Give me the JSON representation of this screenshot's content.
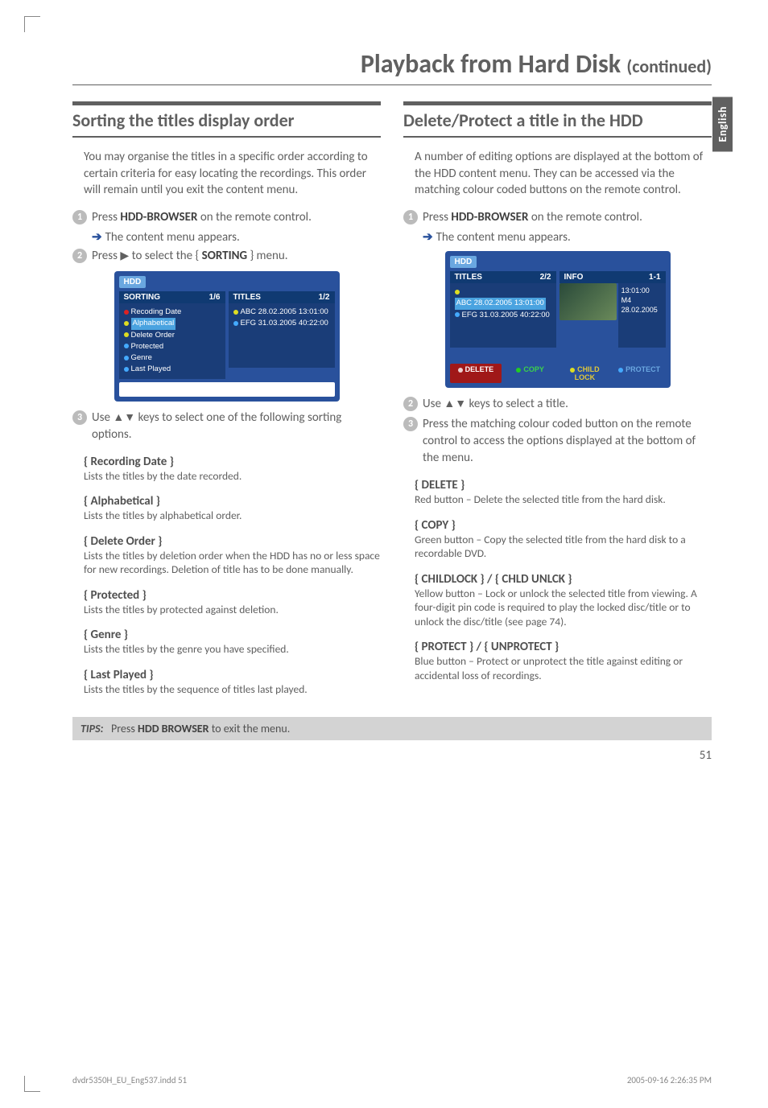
{
  "page": {
    "title_main": "Playback from Hard Disk",
    "title_cont": "(continued)",
    "lang_tab": "English",
    "page_number": "51",
    "footer_file": "dvdr5350H_EU_Eng537.indd   51",
    "footer_ts": "2005-09-16   2:26:35 PM"
  },
  "tips": {
    "label": "TIPS:",
    "text": "Press",
    "button": "HDD BROWSER",
    "text2": "to exit the menu."
  },
  "left": {
    "heading": "Sorting the titles display order",
    "intro": "You may organise the titles in a specific order according to certain criteria for easy locating the recordings. This order will remain until you exit the content menu.",
    "step1_a": "Press",
    "step1_b": "HDD-BROWSER",
    "step1_c": "on the remote control.",
    "step1_res": "The content menu appears.",
    "step2_a": "Press",
    "step2_tri": "▶",
    "step2_b": "to select the {",
    "step2_c": "SORTING",
    "step2_d": "} menu.",
    "step3_a": "Use",
    "step3_tri": "▲▼",
    "step3_b": "keys to select one of the following sorting options.",
    "opts": {
      "rec_h": "{ Recording Date }",
      "rec_d": "Lists the titles by the date recorded.",
      "alpha_h": "{ Alphabetical }",
      "alpha_d": "Lists the titles by alphabetical order.",
      "del_h": "{ Delete Order }",
      "del_d": "Lists the titles by deletion order when the HDD has no or less space for new recordings. Deletion of title has to be done manually.",
      "prot_h": "{ Protected }",
      "prot_d": "Lists the titles by protected against deletion.",
      "genre_h": "{ Genre }",
      "genre_d": "Lists the titles by the genre you have specified.",
      "last_h": "{ Last Played }",
      "last_d": "Lists the titles by the sequence of titles last played."
    },
    "osd": {
      "hdd": "HDD",
      "sorting_hd": "SORTING",
      "sorting_ct": "1/6",
      "titles_hd": "TITLES",
      "titles_ct": "1/2",
      "items": [
        "Recoding Date",
        "Alphabetical",
        "Delete Order",
        "Protected",
        "Genre",
        "Last Played"
      ],
      "titles": [
        "ABC 28.02.2005  13:01:00",
        "EFG 31.03.2005  40:22:00"
      ]
    }
  },
  "right": {
    "heading": "Delete/Protect a title in the HDD",
    "intro": "A number of editing options are displayed at the bottom of the HDD content menu. They can be accessed via the matching colour coded buttons on the remote control.",
    "step1_a": "Press",
    "step1_b": "HDD-BROWSER",
    "step1_c": "on the remote control.",
    "step1_res": "The content menu appears.",
    "step2_a": "Use",
    "step2_tri": "▲▼",
    "step2_b": "keys to select a title.",
    "step3": "Press the matching colour coded button on the remote control to access the options displayed at the bottom of the menu.",
    "opts": {
      "del_h": "{ DELETE }",
      "del_d": "Red button – Delete the selected title from the hard disk.",
      "copy_h": "{ COPY }",
      "copy_d": "Green button – Copy the selected title from the hard disk to a recordable DVD.",
      "lock_h": "{ CHILDLOCK } / { CHLD UNLCK }",
      "lock_d": "Yellow button – Lock or unlock the selected title from viewing.  A four-digit pin code is required to play the locked disc/title or to unlock the disc/title (see page 74).",
      "prot_h": "{ PROTECT } / { UNPROTECT }",
      "prot_d": "Blue button – Protect or unprotect the title against editing or accidental loss of recordings."
    },
    "osd": {
      "hdd": "HDD",
      "titles_hd": "TITLES",
      "titles_ct": "2/2",
      "info_hd": "INFO",
      "info_ct": "1-1",
      "titles": [
        "ABC 28.02.2005  13:01:00",
        "EFG 31.03.2005  40:22:00"
      ],
      "info": [
        "13:01:00",
        "M4",
        "28.02.2005"
      ],
      "btns": {
        "del": "DELETE",
        "copy": "COPY",
        "lock": "CHILD LOCK",
        "prot": "PROTECT"
      }
    }
  }
}
